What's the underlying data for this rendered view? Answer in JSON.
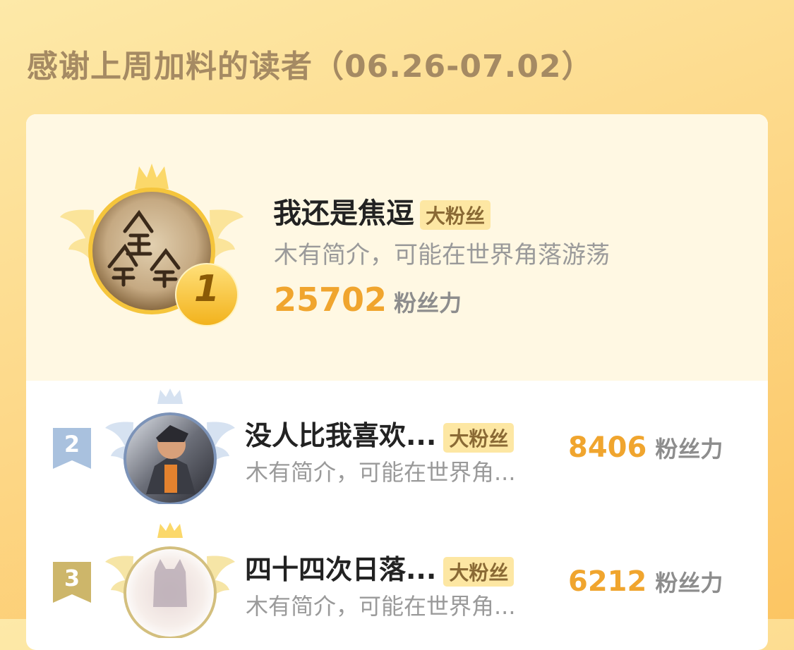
{
  "header": {
    "title": "感谢上周加料的读者（06.26-07.02）"
  },
  "colors": {
    "accent_score": "#f0a52e",
    "badge_bg": "#fde7a3",
    "gold": "#f5c12f",
    "silver": "#a9c1de",
    "bronze": "#cdb66a"
  },
  "readers": [
    {
      "rank": "1",
      "name": "我还是焦逗",
      "badge": "大粉丝",
      "bio": "木有简介，可能在世界角落游荡",
      "score": "25702",
      "unit": "粉丝力"
    },
    {
      "rank": "2",
      "name": "没人比我喜欢...",
      "badge": "大粉丝",
      "bio": "木有简介，可能在世界角...",
      "score": "8406",
      "unit": "粉丝力"
    },
    {
      "rank": "3",
      "name": "四十四次日落...",
      "badge": "大粉丝",
      "bio": "木有简介，可能在世界角...",
      "score": "6212",
      "unit": "粉丝力"
    }
  ]
}
